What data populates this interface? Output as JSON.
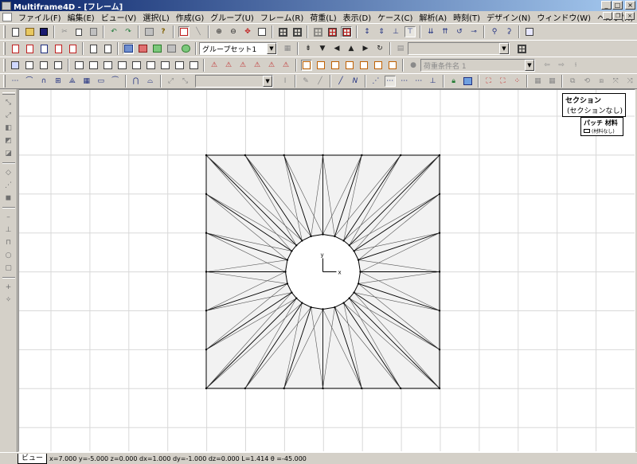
{
  "window": {
    "title": "Multiframe4D - [フレーム]",
    "minimize_label": "_",
    "maximize_label": "□",
    "close_label": "×"
  },
  "menu": {
    "items": [
      "ファイル(F)",
      "編集(E)",
      "ビュー(V)",
      "選択(L)",
      "作成(G)",
      "グループ(U)",
      "フレーム(R)",
      "荷重(L)",
      "表示(D)",
      "ケース(C)",
      "解析(A)",
      "時刻(T)",
      "デザイン(N)",
      "ウィンドウ(W)",
      "ヘルプ(H)"
    ],
    "mdi_minimize_label": "_",
    "mdi_restore_label": "❐",
    "mdi_close_label": "×"
  },
  "toolbar": {
    "group_set_value": "グループセット1",
    "load_case_value": "荷重条件名 1"
  },
  "legend": {
    "section_title": "セクション",
    "section_item": "(セクションなし)",
    "patch_title": "パッチ 材料",
    "patch_item": "(材料なし)"
  },
  "axes": {
    "x_label": "x",
    "y_label": "y"
  },
  "status": {
    "view_tab": "ビュー",
    "coordinates": "x=7.000  y=-5.000  z=0.000  dx=1.000  dy=-1.000  dz=0.000  L=1.414  θ =-45.000"
  },
  "colors": {
    "title_bar_start": "#0a246a",
    "title_bar_end": "#a6caf0",
    "face": "#d4d0c8",
    "canvas": "#ffffff",
    "grid": "#d8d8d8",
    "mesh_fill": "#f2f2f2",
    "mesh_line": "#000000"
  }
}
